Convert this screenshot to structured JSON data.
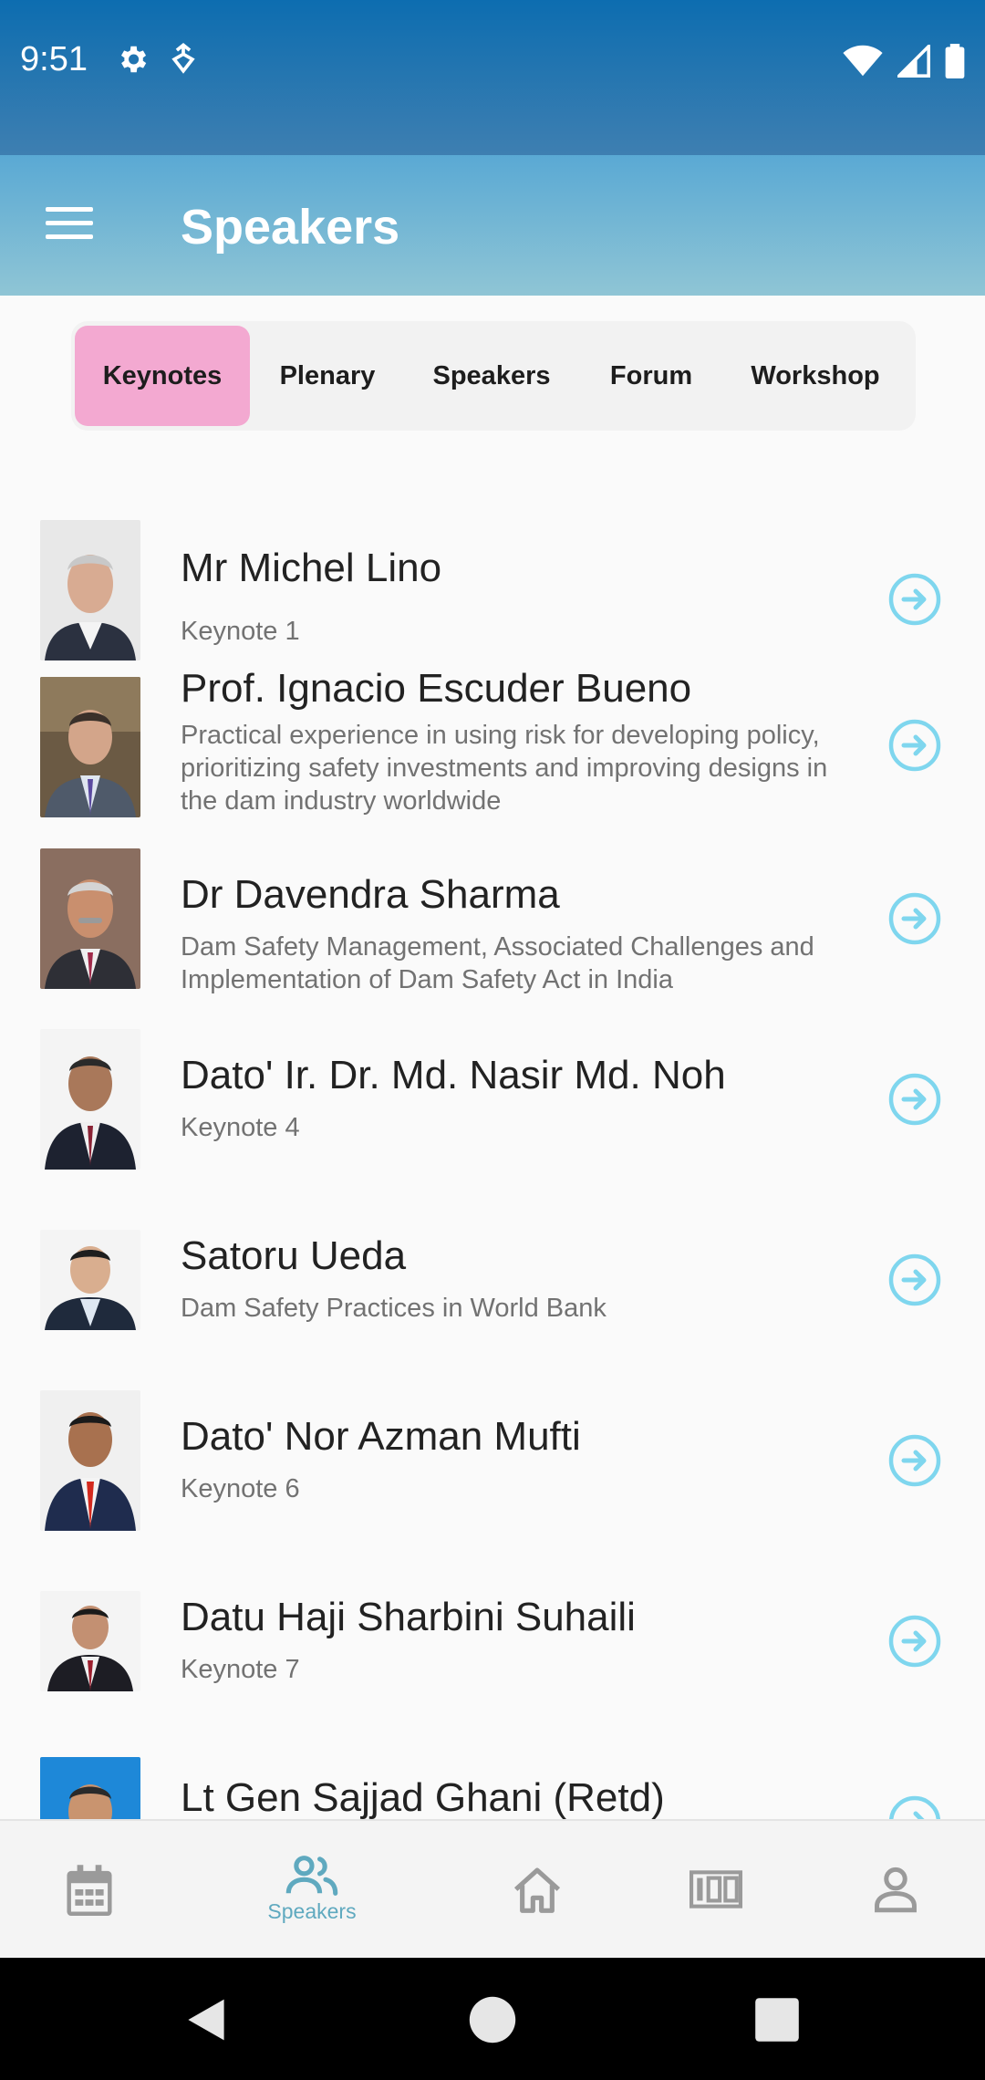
{
  "status_bar": {
    "time": "9:51",
    "left_icons": [
      "gear-icon",
      "download-badge-icon"
    ],
    "right_icons": [
      "wifi-icon",
      "signal-icon",
      "battery-icon"
    ]
  },
  "app_bar": {
    "title": "Speakers",
    "menu_icon": "hamburger-menu-icon"
  },
  "tabs": [
    {
      "label": "Keynotes",
      "active": true
    },
    {
      "label": "Plenary",
      "active": false
    },
    {
      "label": "Speakers",
      "active": false
    },
    {
      "label": "Forum",
      "active": false
    },
    {
      "label": "Workshop",
      "active": false
    }
  ],
  "speakers": [
    {
      "name": "Mr Michel Lino",
      "subtitle": "Keynote 1"
    },
    {
      "name": "Prof. Ignacio Escuder Bueno",
      "subtitle": "Practical experience in using risk for developing policy, prioritizing safety investments and improving designs in the dam industry worldwide"
    },
    {
      "name": "Dr Davendra Sharma",
      "subtitle": "Dam Safety Management, Associated Challenges and Implementation of Dam Safety Act in India"
    },
    {
      "name": "Dato' Ir. Dr. Md. Nasir Md. Noh",
      "subtitle": "Keynote 4"
    },
    {
      "name": "Satoru Ueda",
      "subtitle": "Dam Safety Practices in World Bank"
    },
    {
      "name": "Dato' Nor Azman Mufti",
      "subtitle": "Keynote 6"
    },
    {
      "name": "Datu Haji Sharbini Suhaili",
      "subtitle": "Keynote 7"
    },
    {
      "name": "Lt Gen Sajjad Ghani (Retd)",
      "subtitle": ""
    }
  ],
  "bottom_nav": [
    {
      "icon": "calendar-icon",
      "label": ""
    },
    {
      "icon": "people-icon",
      "label": "Speakers",
      "active": true
    },
    {
      "icon": "home-icon",
      "label": ""
    },
    {
      "icon": "ticket-icon",
      "label": ""
    },
    {
      "icon": "person-icon",
      "label": ""
    }
  ],
  "colors": {
    "status_bar": "#0d6db0",
    "app_bar": "#5aa9d4",
    "active_tab": "#f3a9d1",
    "arrow_accent": "#7fd6ee",
    "nav_active": "#5fa9bf"
  }
}
